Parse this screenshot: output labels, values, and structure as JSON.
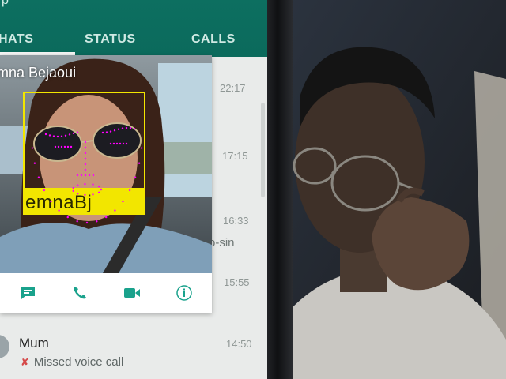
{
  "header": {
    "title_fragment": "p",
    "tabs": [
      {
        "label": "HATS",
        "active": true
      },
      {
        "label": "STATUS",
        "active": false
      },
      {
        "label": "CALLS",
        "active": false
      }
    ],
    "color": "#0b6a5c"
  },
  "popup": {
    "name": "mna Bejaoui",
    "actions": [
      "message-icon",
      "phone-icon",
      "video-icon",
      "info-icon"
    ],
    "accent": "#1aa28c"
  },
  "chat_list": {
    "times": [
      "22:17",
      "17:15",
      "16:33",
      "15:55",
      "14:50"
    ],
    "preview_fragment": "o-sin",
    "mum": {
      "name": "Mum",
      "status": "Missed voice call"
    }
  },
  "detection": {
    "label": "emnaBj",
    "box_color": "#f2e600",
    "landmark_color": "#ff00ff"
  }
}
